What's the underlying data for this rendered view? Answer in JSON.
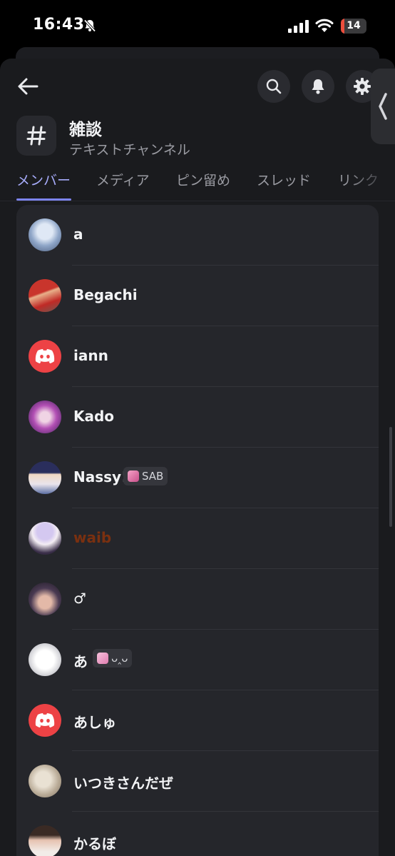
{
  "status_bar": {
    "time": "16:43",
    "battery": "14",
    "battery_percent": 14,
    "mute_icon": "bell-slash-icon",
    "signal_icon": "cellular-signal-icon",
    "wifi_icon": "wifi-icon"
  },
  "header": {
    "back_icon": "arrow-left-icon",
    "search_icon": "search-icon",
    "notifications_icon": "bell-icon",
    "settings_icon": "gear-icon",
    "side_tab_icon": "chevron-left-icon"
  },
  "channel": {
    "icon": "hashtag-icon",
    "name": "雑談",
    "type": "テキストチャンネル"
  },
  "tabs": [
    {
      "label": "メンバー",
      "active": true
    },
    {
      "label": "メディア",
      "active": false
    },
    {
      "label": "ピン留め",
      "active": false
    },
    {
      "label": "スレッド",
      "active": false
    },
    {
      "label": "リンク",
      "active": false
    }
  ],
  "members": [
    {
      "name": "a",
      "avatar": "anime-avatar"
    },
    {
      "name": "Begachi",
      "avatar": "photo-avatar"
    },
    {
      "name": "iann",
      "avatar": "discord-default-avatar"
    },
    {
      "name": "Kado",
      "avatar": "anime-avatar"
    },
    {
      "name": "Nassy!",
      "avatar": "anime-avatar",
      "tag": "SAB"
    },
    {
      "name": "waib",
      "avatar": "anime-avatar",
      "name_color": "#7a3010"
    },
    {
      "name": "♂",
      "avatar": "anime-avatar"
    },
    {
      "name": "あ",
      "avatar": "sketch-avatar",
      "tag": "ᴗ‸ᴗ"
    },
    {
      "name": "あしゅ",
      "avatar": "discord-default-avatar"
    },
    {
      "name": "いつきさんだぜ",
      "avatar": "photo-avatar"
    },
    {
      "name": "かるぼ",
      "avatar": "photo-avatar"
    }
  ],
  "colors": {
    "background": "#1a1b1e",
    "card": "#25262b",
    "accent": "#7d84f0",
    "discord_red": "#ed4245"
  }
}
